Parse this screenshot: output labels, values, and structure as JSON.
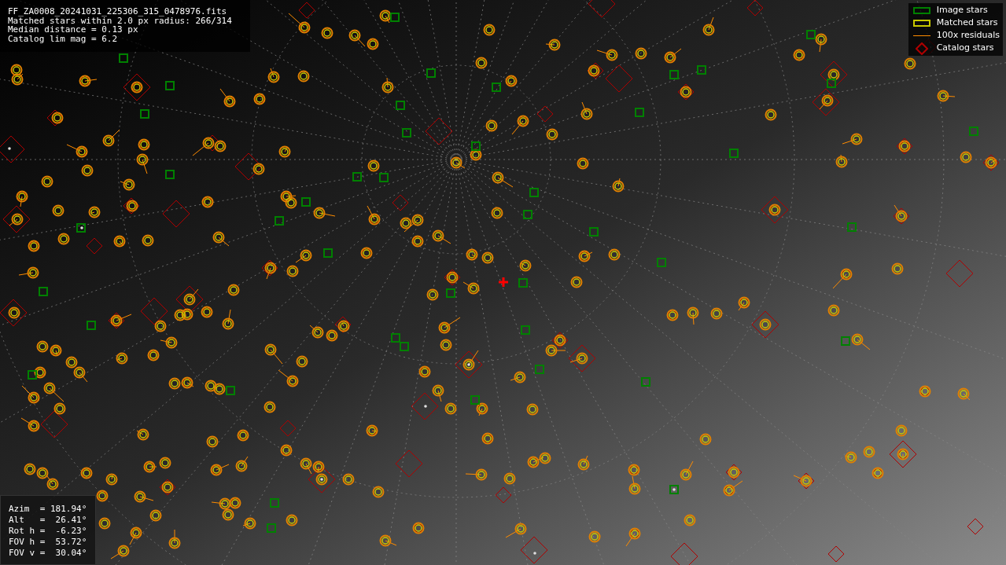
{
  "header": [
    "FF_ZA0008_20241031_225306_315_0478976.fits",
    "Matched stars within 2.0 px radius: 266/314",
    "Median distance = 0.13 px",
    "Catalog lim mag = 6.2"
  ],
  "legend": [
    {
      "kind": "image",
      "label": "Image stars",
      "color": "#008000"
    },
    {
      "kind": "matched",
      "label": "Matched stars",
      "color": "#c8c800"
    },
    {
      "kind": "residual",
      "label": "100x residuals",
      "color": "#ff8c00"
    },
    {
      "kind": "catalog",
      "label": "Catalog stars",
      "color": "#b00000"
    }
  ],
  "pointing": [
    "Azim  = 181.94°",
    "Alt   =  26.41°",
    "Rot h =  -6.23°",
    "FOV h =  53.72°",
    "FOV v =  30.04°"
  ]
}
